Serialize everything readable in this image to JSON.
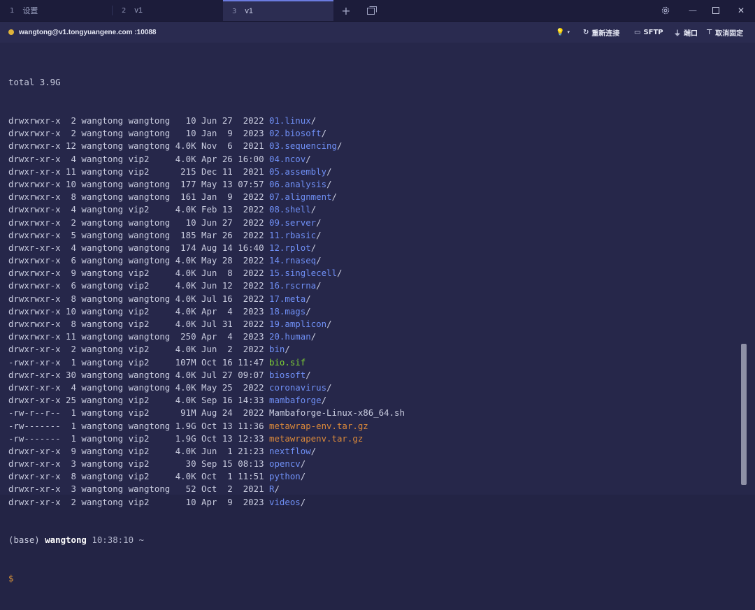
{
  "tabs": [
    {
      "num": "1",
      "label": "设置"
    },
    {
      "num": "2",
      "label": "v1"
    },
    {
      "num": "3",
      "label": "v1"
    }
  ],
  "tab_icons": {
    "new_tab": "+",
    "window": "window-icon",
    "settings": "gear-icon",
    "minimize": "—",
    "maximize": "☐",
    "close": "✕"
  },
  "header": {
    "host": "wangtong@v1.tongyuangene.com :10088",
    "status_color": "#e0b43a",
    "reconnect": "重新连接",
    "sftp": "SFTP",
    "port": "端口",
    "unpin": "取消固定"
  },
  "terminal": {
    "total": "total 3.9G",
    "entries": [
      {
        "info": "drwxrwxr-x  2 wangtong wangtong   10 Jun 27  2022 ",
        "name": "01.linux",
        "suffix": "/",
        "kind": "dir"
      },
      {
        "info": "drwxrwxr-x  2 wangtong wangtong   10 Jan  9  2023 ",
        "name": "02.biosoft",
        "suffix": "/",
        "kind": "dir"
      },
      {
        "info": "drwxrwxr-x 12 wangtong wangtong 4.0K Nov  6  2021 ",
        "name": "03.sequencing",
        "suffix": "/",
        "kind": "dir"
      },
      {
        "info": "drwxr-xr-x  4 wangtong vip2     4.0K Apr 26 16:00 ",
        "name": "04.ncov",
        "suffix": "/",
        "kind": "dir"
      },
      {
        "info": "drwxr-xr-x 11 wangtong vip2      215 Dec 11  2021 ",
        "name": "05.assembly",
        "suffix": "/",
        "kind": "dir"
      },
      {
        "info": "drwxrwxr-x 10 wangtong wangtong  177 May 13 07:57 ",
        "name": "06.analysis",
        "suffix": "/",
        "kind": "dir"
      },
      {
        "info": "drwxrwxr-x  8 wangtong wangtong  161 Jan  9  2022 ",
        "name": "07.alignment",
        "suffix": "/",
        "kind": "dir"
      },
      {
        "info": "drwxrwxr-x  4 wangtong vip2     4.0K Feb 13  2022 ",
        "name": "08.shell",
        "suffix": "/",
        "kind": "dir"
      },
      {
        "info": "drwxrwxr-x  2 wangtong wangtong   10 Jun 27  2022 ",
        "name": "09.server",
        "suffix": "/",
        "kind": "dir"
      },
      {
        "info": "drwxrwxr-x  5 wangtong wangtong  185 Mar 26  2022 ",
        "name": "11.rbasic",
        "suffix": "/",
        "kind": "dir"
      },
      {
        "info": "drwxr-xr-x  4 wangtong wangtong  174 Aug 14 16:40 ",
        "name": "12.rplot",
        "suffix": "/",
        "kind": "dir"
      },
      {
        "info": "drwxrwxr-x  6 wangtong wangtong 4.0K May 28  2022 ",
        "name": "14.rnaseq",
        "suffix": "/",
        "kind": "dir"
      },
      {
        "info": "drwxrwxr-x  9 wangtong vip2     4.0K Jun  8  2022 ",
        "name": "15.singlecell",
        "suffix": "/",
        "kind": "dir"
      },
      {
        "info": "drwxrwxr-x  6 wangtong vip2     4.0K Jun 12  2022 ",
        "name": "16.rscrna",
        "suffix": "/",
        "kind": "dir"
      },
      {
        "info": "drwxrwxr-x  8 wangtong wangtong 4.0K Jul 16  2022 ",
        "name": "17.meta",
        "suffix": "/",
        "kind": "dir"
      },
      {
        "info": "drwxrwxr-x 10 wangtong vip2     4.0K Apr  4  2023 ",
        "name": "18.mags",
        "suffix": "/",
        "kind": "dir"
      },
      {
        "info": "drwxrwxr-x  8 wangtong vip2     4.0K Jul 31  2022 ",
        "name": "19.amplicon",
        "suffix": "/",
        "kind": "dir"
      },
      {
        "info": "drwxrwxr-x 11 wangtong wangtong  250 Apr  4  2023 ",
        "name": "20.human",
        "suffix": "/",
        "kind": "dir"
      },
      {
        "info": "drwxr-xr-x  2 wangtong vip2     4.0K Jun  2  2022 ",
        "name": "bin",
        "suffix": "/",
        "kind": "dir"
      },
      {
        "info": "-rwxr-xr-x  1 wangtong vip2     107M Oct 16 11:47 ",
        "name": "bio.sif",
        "suffix": "",
        "kind": "exe"
      },
      {
        "info": "drwxr-xr-x 30 wangtong wangtong 4.0K Jul 27 09:07 ",
        "name": "biosoft",
        "suffix": "/",
        "kind": "dir"
      },
      {
        "info": "drwxr-xr-x  4 wangtong wangtong 4.0K May 25  2022 ",
        "name": "coronavirus",
        "suffix": "/",
        "kind": "dir"
      },
      {
        "info": "drwxr-xr-x 25 wangtong vip2     4.0K Sep 16 14:33 ",
        "name": "mambaforge",
        "suffix": "/",
        "kind": "dir"
      },
      {
        "info": "-rw-r--r--  1 wangtong vip2      91M Aug 24  2022 ",
        "name": "Mambaforge-Linux-x86_64.sh",
        "suffix": "",
        "kind": "file"
      },
      {
        "info": "-rw-------  1 wangtong wangtong 1.9G Oct 13 11:36 ",
        "name": "metawrap-env.tar.gz",
        "suffix": "",
        "kind": "arc"
      },
      {
        "info": "-rw-------  1 wangtong vip2     1.9G Oct 13 12:33 ",
        "name": "metawrapenv.tar.gz",
        "suffix": "",
        "kind": "arc"
      },
      {
        "info": "drwxr-xr-x  9 wangtong vip2     4.0K Jun  1 21:23 ",
        "name": "nextflow",
        "suffix": "/",
        "kind": "dir"
      },
      {
        "info": "drwxr-xr-x  3 wangtong vip2       30 Sep 15 08:13 ",
        "name": "opencv",
        "suffix": "/",
        "kind": "dir"
      },
      {
        "info": "drwxr-xr-x  8 wangtong vip2     4.0K Oct  1 11:51 ",
        "name": "python",
        "suffix": "/",
        "kind": "dir"
      },
      {
        "info": "drwxr-xr-x  3 wangtong wangtong   52 Oct  2  2021 ",
        "name": "R",
        "suffix": "/",
        "kind": "dir"
      },
      {
        "info": "drwxr-xr-x  2 wangtong vip2       10 Apr  9  2023 ",
        "name": "videos",
        "suffix": "/",
        "kind": "dir"
      }
    ],
    "prompt": {
      "env": "(base) ",
      "user": "wangtong",
      "time": " 10:38:10 ~",
      "dollar": "$"
    },
    "colors": {
      "dir": "#6f8ff5",
      "exe": "#7fd234",
      "arc": "#d9883a"
    }
  }
}
